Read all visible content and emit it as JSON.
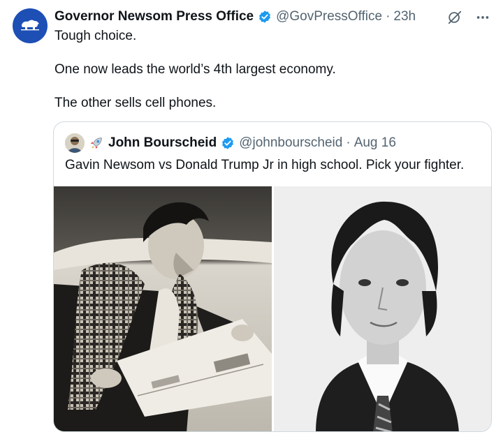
{
  "tweet": {
    "author_name": "Governor Newsom Press Office",
    "author_handle": "@GovPressOffice",
    "separator": "·",
    "timestamp": "23h",
    "body_lines": [
      "Tough choice.",
      "One now leads the world’s 4th largest economy.",
      "The other sells cell phones."
    ],
    "icons": {
      "avatar": "california-bear-icon",
      "verified": "verified-badge-icon",
      "grok": "grok-icon",
      "more": "more-options-icon"
    },
    "colors": {
      "verified": "#1d9bf0",
      "avatar_bg": "#1d4fb5",
      "secondary_text": "#536471",
      "border": "#cfd9de"
    }
  },
  "quoted_tweet": {
    "author_name": "John Bourscheid",
    "author_handle": "@johnbourscheid",
    "separator": "·",
    "date": "Aug 16",
    "emoji": "rocket-icon",
    "text": "Gavin Newsom vs Donald Trump Jr in high school. Pick your fighter.",
    "images": [
      {
        "name": "left-photo",
        "subject": "black-and-white photo of a young man in plaid scarf reading a newspaper"
      },
      {
        "name": "right-photo",
        "subject": "black-and-white yearbook portrait of a young man in suit and tie"
      }
    ]
  }
}
